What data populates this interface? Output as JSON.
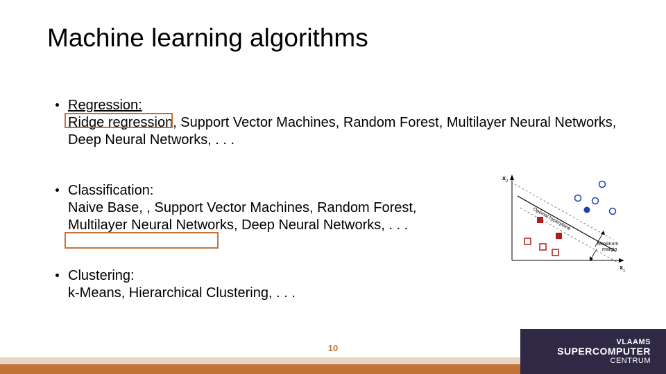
{
  "title": "Machine learning algorithms",
  "bullets": {
    "b1": {
      "head": "Regression:",
      "body": "Ridge regression, Support Vector Machines, Random Forest, Multilayer Neural Networks, Deep Neural Networks, . . ."
    },
    "b2": {
      "head": "Classification:",
      "body": "Naive Base, , Support Vector Machines, Random Forest, Multilayer Neural Networks, Deep Neural Networks, . . ."
    },
    "b3": {
      "head": "Clustering:",
      "body": "k-Means, Hierarchical Clustering, . . ."
    }
  },
  "fig": {
    "axis_y": "x₂",
    "axis_x": "x₁",
    "line_label": "Optimal hyperplane",
    "margin_label": "Maximum margin"
  },
  "footer": {
    "slide_no": "10",
    "brand_l1": "VLAAMS",
    "brand_l2": "SUPERCOMPUTER",
    "brand_l3": "CENTRUM"
  },
  "colors": {
    "accent": "#c27438",
    "footer_dark": "#302945"
  }
}
